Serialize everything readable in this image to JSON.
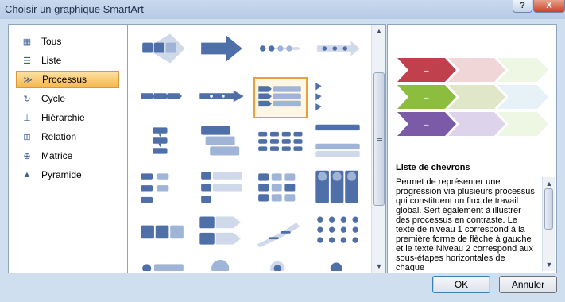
{
  "window": {
    "title": "Choisir un graphique SmartArt",
    "help_label": "?",
    "close_label": "X"
  },
  "categories": [
    {
      "label": "Tous",
      "icon": "all-icon",
      "selected": false
    },
    {
      "label": "Liste",
      "icon": "list-icon",
      "selected": false
    },
    {
      "label": "Processus",
      "icon": "process-icon",
      "selected": true
    },
    {
      "label": "Cycle",
      "icon": "cycle-icon",
      "selected": false
    },
    {
      "label": "Hiérarchie",
      "icon": "hierarchy-icon",
      "selected": false
    },
    {
      "label": "Relation",
      "icon": "relation-icon",
      "selected": false
    },
    {
      "label": "Matrice",
      "icon": "matrix-icon",
      "selected": false
    },
    {
      "label": "Pyramide",
      "icon": "pyramid-icon",
      "selected": false
    }
  ],
  "gallery": {
    "selected_index": 6,
    "count": 24
  },
  "preview": {
    "title": "Liste de chevrons",
    "description": "Permet de représenter une progression via plusieurs processus qui constituent un flux de travail global. Sert également à illustrer des processus en contraste. Le texte de niveau 1 correspond à la première forme de flèche à gauche et le texte Niveau 2 correspond aux sous-étapes horizontales de chaque"
  },
  "buttons": {
    "ok": "OK",
    "cancel": "Annuler"
  },
  "colors": {
    "accent": "#4f6fa8",
    "selection": "#f6b64c",
    "red": "#c0404d",
    "green": "#8cbd3f",
    "purple": "#7b5aa8"
  }
}
